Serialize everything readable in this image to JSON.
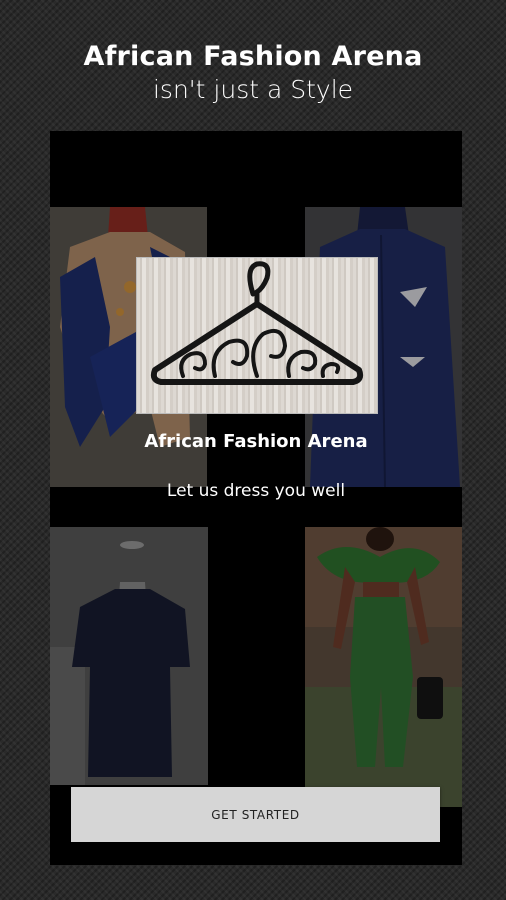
{
  "promo": {
    "title": "African Fashion Arena",
    "subtitle": "isn't just a Style"
  },
  "app": {
    "name": "African Fashion Arena",
    "tagline": "Let us dress you well",
    "logo_icon": "clothes-hanger-icon"
  },
  "cta": {
    "label": "GET STARTED"
  }
}
